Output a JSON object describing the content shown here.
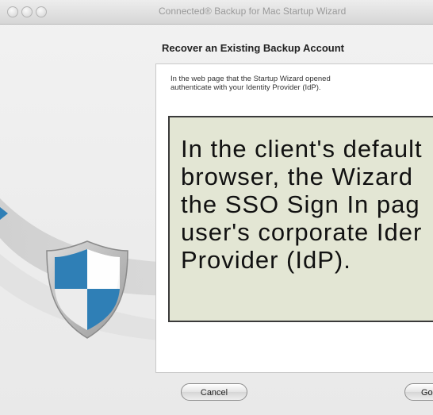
{
  "window": {
    "title": "Connected® Backup for Mac Startup Wizard"
  },
  "page": {
    "heading": "Recover an Existing Backup Account",
    "intro_line1": "In the web page that the Startup Wizard opened",
    "intro_line2": "authenticate with your Identity Provider (IdP)."
  },
  "callout": {
    "text": "In the client's default\nbrowser, the Wizard\nthe SSO Sign In pag\nuser's corporate Ider\nProvider (IdP)."
  },
  "buttons": {
    "cancel_label": "Cancel",
    "go_label": "Go"
  },
  "icons": {
    "shield": "shield-icon",
    "pointer": "arrow-pointer-icon"
  },
  "colors": {
    "callout_bg": "#e3e6d4",
    "shield_blue": "#2f7fb6"
  }
}
